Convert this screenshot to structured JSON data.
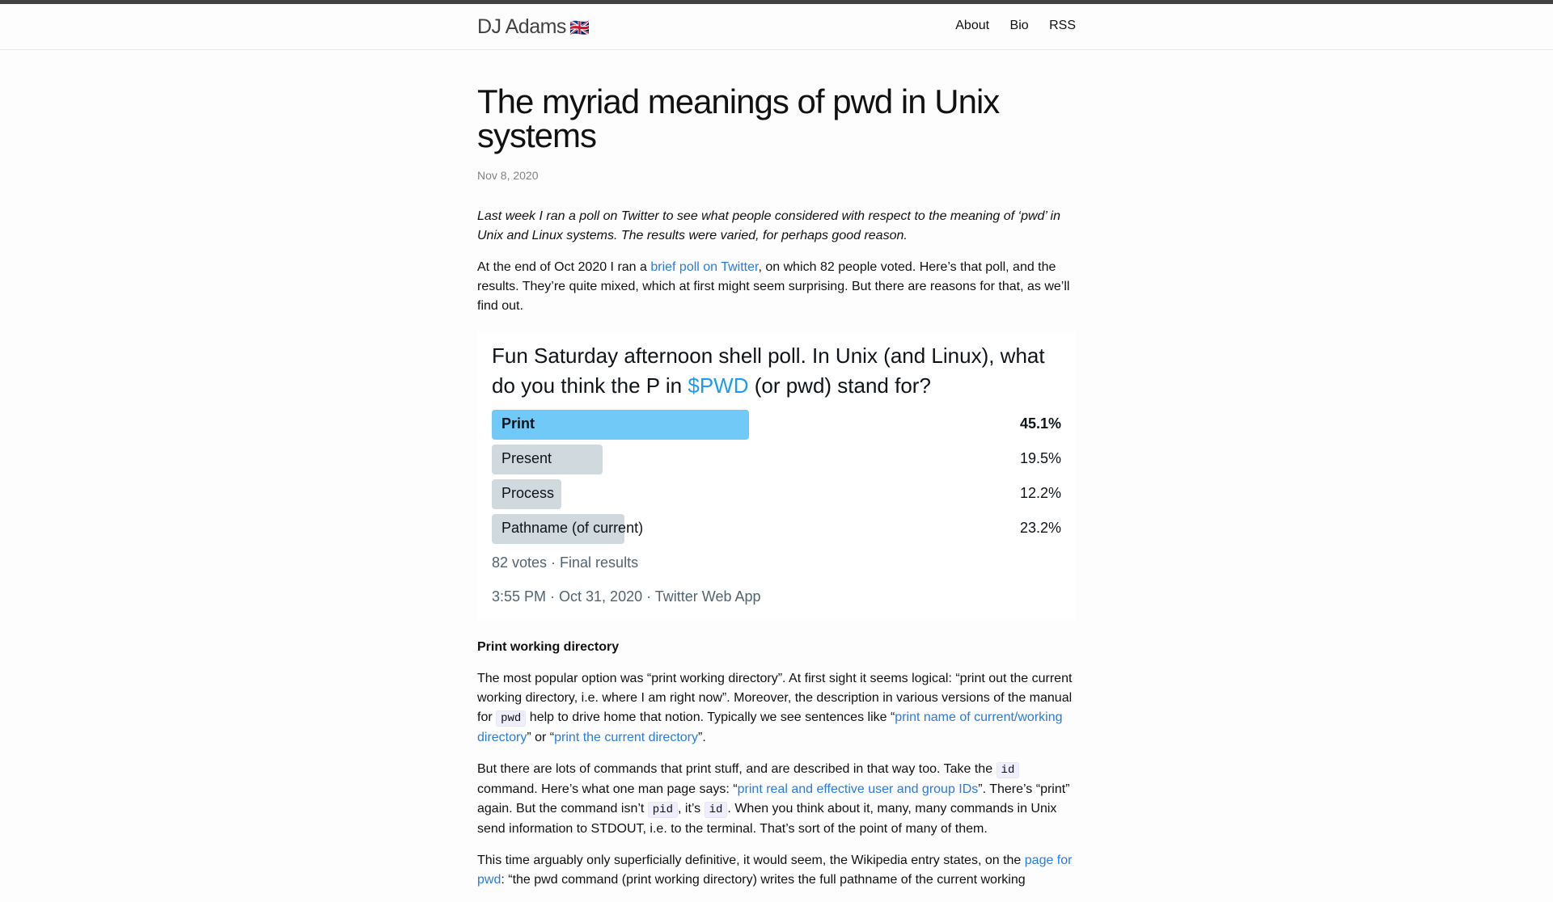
{
  "site": {
    "title": "DJ Adams",
    "flag": "🇬🇧",
    "nav": [
      "About",
      "Bio",
      "RSS"
    ]
  },
  "post": {
    "title": "The myriad meanings of pwd in Unix systems",
    "date": "Nov 8, 2020",
    "lead": "Last week I ran a poll on Twitter to see what people considered with respect to the meaning of ‘pwd’ in Unix and Linux systems. The results were varied, for perhaps good reason.",
    "p1_a": "At the end of Oct 2020 I ran a ",
    "p1_link": "brief poll on Twitter",
    "p1_b": ", on which 82 people voted. Here’s that poll, and the results. They’re quite mixed, which at first might seem surprising. But there are reasons for that, as we’ll find out.",
    "section1": "Print working directory",
    "p2_a": "The most popular option was “print working directory”. At first sight it seems logical: “print out the current working directory, i.e. where I am right now”. Moreover, the description in various versions of the manual for ",
    "p2_code": "pwd",
    "p2_b": " help to drive home that notion. Typically we see sentences like “",
    "p2_link1": "print name of current/working directory",
    "p2_c": "” or “",
    "p2_link2": "print the current directory",
    "p2_d": "”.",
    "p3_a": "But there are lots of commands that print stuff, and are described in that way too. Take the ",
    "p3_code1": "id",
    "p3_b": " command. Here’s what one man page says: “",
    "p3_link": "print real and effective user and group IDs",
    "p3_c": "”. There’s “print” again. But the command isn’t ",
    "p3_code2": "pid",
    "p3_d": ", it’s ",
    "p3_code3": "id",
    "p3_e": ". When you think about it, many, many commands in Unix send information to STDOUT, i.e. to the terminal. That’s sort of the point of many of them.",
    "p4_a": "This time arguably only superficially definitive, it would seem, the Wikipedia entry states, on the ",
    "p4_link": "page for pwd",
    "p4_b": ": “the pwd command (print working directory) writes the full pathname of the current working"
  },
  "poll": {
    "question_a": "Fun Saturday afternoon shell poll. In Unix (and Linux), what do you think the P in ",
    "question_hl": "$PWD",
    "question_b": " (or pwd) stand for?",
    "options": [
      {
        "label": "Print",
        "pct": "45.1%",
        "value": 45.1
      },
      {
        "label": "Present",
        "pct": "19.5%",
        "value": 19.5
      },
      {
        "label": "Process",
        "pct": "12.2%",
        "value": 12.2
      },
      {
        "label": "Pathname (of current)",
        "pct": "23.2%",
        "value": 23.2
      }
    ],
    "votes": "82 votes · Final results",
    "timestamp": "3:55 PM · Oct 31, 2020 · Twitter Web App"
  }
}
